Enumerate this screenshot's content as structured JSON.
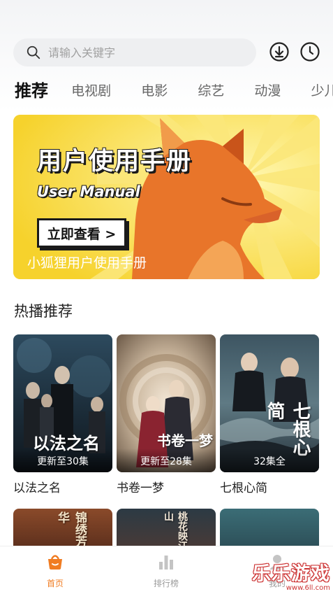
{
  "search": {
    "placeholder": "请输入关键字"
  },
  "top_icons": [
    "download-icon",
    "history-icon"
  ],
  "tabs": [
    {
      "label": "推荐",
      "active": true
    },
    {
      "label": "电视剧"
    },
    {
      "label": "电影"
    },
    {
      "label": "综艺"
    },
    {
      "label": "动漫"
    },
    {
      "label": "少儿"
    }
  ],
  "banner": {
    "title": "用户使用手册",
    "subtitle": "User Manual",
    "button": "立即查看 >",
    "caption": "小狐狸用户使用手册"
  },
  "section": {
    "title": "热播推荐",
    "items": [
      {
        "name": "以法之名",
        "badge": "更新至30集",
        "poster_text": "以法之名"
      },
      {
        "name": "书卷一梦",
        "badge": "更新至28集",
        "poster_text": "书卷一梦"
      },
      {
        "name": "七根心简",
        "badge": "32集全",
        "poster_text": "七根心简"
      }
    ],
    "row2_poster_texts": [
      "锦绣芳华",
      "桃花映江山",
      ""
    ]
  },
  "bottom_nav": [
    {
      "label": "首页",
      "icon": "home-icon",
      "active": true
    },
    {
      "label": "排行榜",
      "icon": "ranking-icon"
    },
    {
      "label": "我的",
      "icon": "profile-icon"
    }
  ],
  "watermark": {
    "text": "乐乐游戏",
    "url": "www.6ll.com"
  },
  "colors": {
    "accent": "#f07c22",
    "banner_yellow": "#f8d93a",
    "fox_orange": "#e8752a"
  }
}
